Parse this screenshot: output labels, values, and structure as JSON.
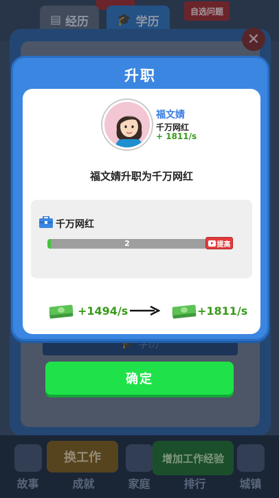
{
  "background": {
    "tabs": [
      "经历",
      "学历"
    ],
    "top_button": "自选问题",
    "strip_label": "学历",
    "nav": [
      "故事",
      "成就",
      "家庭",
      "排行",
      "城镇"
    ],
    "switch_job_label": "换工作",
    "exp_label": "增加工作经验"
  },
  "modal": {
    "title": "升职",
    "character": {
      "name": "福文婧",
      "job": "千万网红",
      "income": "+ 1811/s"
    },
    "promotion_text": "福文婧升职为千万网红",
    "job_card": {
      "job_name": "千万网红",
      "level": "2",
      "progress": 0.02,
      "boost_label": "提高"
    },
    "income_change": {
      "old": "+1494/s",
      "new": "+1811/s"
    },
    "confirm_label": "确定"
  },
  "colors": {
    "modal_blue": "#3b86e0",
    "green_button": "#1fe24a",
    "income_green": "#3a9a1c",
    "boost_red": "#e23b3b"
  }
}
